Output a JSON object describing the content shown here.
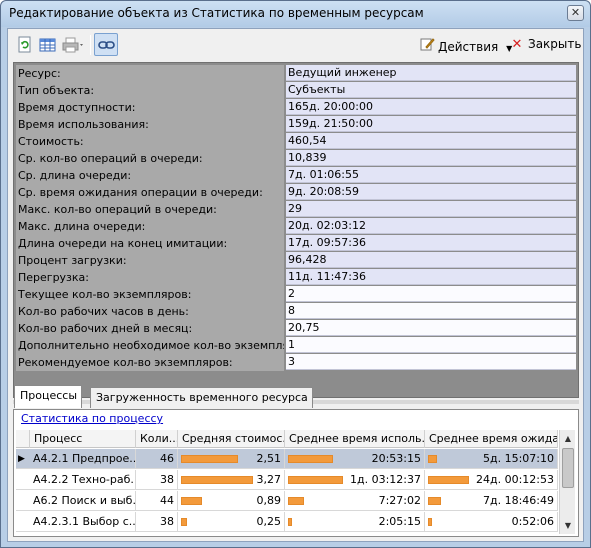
{
  "window": {
    "title": "Редактирование объекта  из Статистика по временным ресурсам",
    "close_glyph": "✕"
  },
  "toolbar": {
    "actions_label": "Действия",
    "close_label": "Закрыть",
    "icons": [
      "refresh-icon",
      "table-icon",
      "print-icon",
      "link-icon"
    ]
  },
  "properties": [
    {
      "label": "Ресурс:",
      "value": "Ведущий инженер"
    },
    {
      "label": "Тип объекта:",
      "value": "Субъекты"
    },
    {
      "label": "Время доступности:",
      "value": "165д. 20:00:00"
    },
    {
      "label": "Время использования:",
      "value": "159д. 21:50:00"
    },
    {
      "label": "Стоимость:",
      "value": "460,54"
    },
    {
      "label": "Ср. кол-во операций в очереди:",
      "value": "10,839"
    },
    {
      "label": "Ср. длина очереди:",
      "value": "7д. 01:06:55"
    },
    {
      "label": "Ср. время ожидания операции в очереди:",
      "value": "9д. 20:08:59"
    },
    {
      "label": "Макс. кол-во операций в очереди:",
      "value": "29"
    },
    {
      "label": "Макс. длина очереди:",
      "value": "20д. 02:03:12"
    },
    {
      "label": "Длина очереди на конец имитации:",
      "value": "17д. 09:57:36"
    },
    {
      "label": "Процент загрузки:",
      "value": "96,428"
    },
    {
      "label": "Перегрузка:",
      "value": "11д. 11:47:36"
    },
    {
      "label": "Текущее кол-во экземпляров:",
      "value": "2"
    },
    {
      "label": "Кол-во рабочих часов в день:",
      "value": "8"
    },
    {
      "label": "Кол-во рабочих дней в месяц:",
      "value": "20,75"
    },
    {
      "label": "Дополнительно необходимое кол-во экземпляров:",
      "value": "1"
    },
    {
      "label": "Рекомендуемое кол-во экземпляров:",
      "value": "3"
    }
  ],
  "tabs": [
    {
      "label": "Процессы",
      "active": true
    },
    {
      "label": "Загруженность временного ресурса",
      "active": false
    }
  ],
  "process_stats_link": "Статистика по процессу",
  "table": {
    "columns": [
      "Процесс",
      "Коли...",
      "Средняя стоимос...",
      "Среднее время исполь...",
      "Среднее время ожида..."
    ],
    "rows": [
      {
        "process": "А4.2.1 Предпрое...",
        "count": "46",
        "cost": "2,51",
        "cost_fill": 0.75,
        "use_time": "20:53:15",
        "use_fill": 0.8,
        "wait_time": "5д. 15:07:10",
        "wait_fill": 0.22,
        "selected": true
      },
      {
        "process": "А4.2.2 Техно-раб...",
        "count": "38",
        "cost": "3,27",
        "cost_fill": 0.95,
        "use_time": "1д. 03:12:37",
        "use_fill": 0.98,
        "wait_time": "24д. 00:12:53",
        "wait_fill": 0.98,
        "selected": false
      },
      {
        "process": "А6.2 Поиск и выб...",
        "count": "44",
        "cost": "0,89",
        "cost_fill": 0.27,
        "use_time": "7:27:02",
        "use_fill": 0.28,
        "wait_time": "7д. 18:46:49",
        "wait_fill": 0.32,
        "selected": false
      },
      {
        "process": "А4.2.3.1 Выбор с...",
        "count": "38",
        "cost": "0,25",
        "cost_fill": 0.08,
        "use_time": "2:05:15",
        "use_fill": 0.08,
        "wait_time": "0:52:06",
        "wait_fill": 0.03,
        "selected": false
      }
    ]
  },
  "colors": {
    "bar": "#f39a3b",
    "grid_label_bg": "#a9a9a9",
    "grid_value_bg": "#e2e4f6",
    "link": "#0000cc"
  }
}
